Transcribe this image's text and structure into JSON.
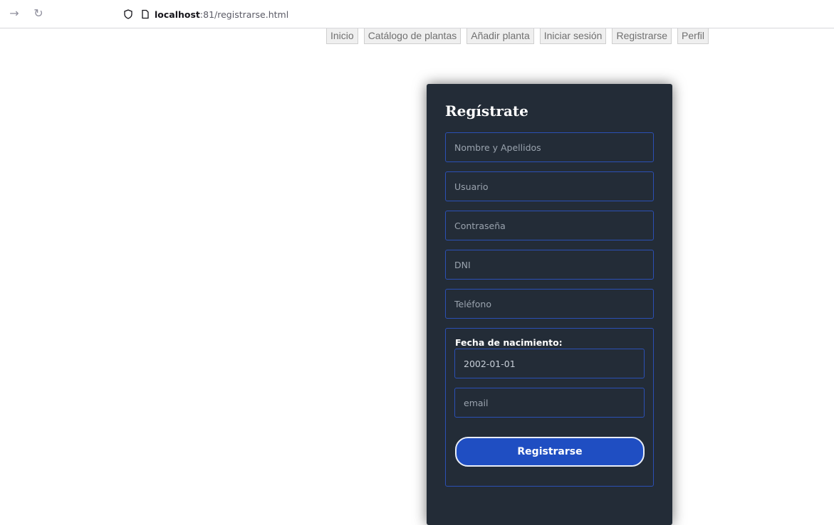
{
  "browser": {
    "url_host": "localhost",
    "url_rest": ":81/registrarse.html"
  },
  "nav": {
    "items": [
      "Inicio",
      "Catálogo de plantas",
      "Añadir planta",
      "Iniciar sesión",
      "Registrarse",
      "Perfil"
    ]
  },
  "form": {
    "title": "Regístrate",
    "nombre_placeholder": "Nombre y Apellidos",
    "usuario_placeholder": "Usuario",
    "password_placeholder": "Contraseña",
    "dni_placeholder": "DNI",
    "telefono_placeholder": "Teléfono",
    "fecha_label": "Fecha de nacimiento:",
    "fecha_value": "2002-01-01",
    "email_placeholder": "email",
    "submit_label": "Registrarse"
  },
  "colors": {
    "card_bg": "#232c37",
    "field_border": "#2b50b5",
    "button_bg": "#1f4ec2"
  }
}
